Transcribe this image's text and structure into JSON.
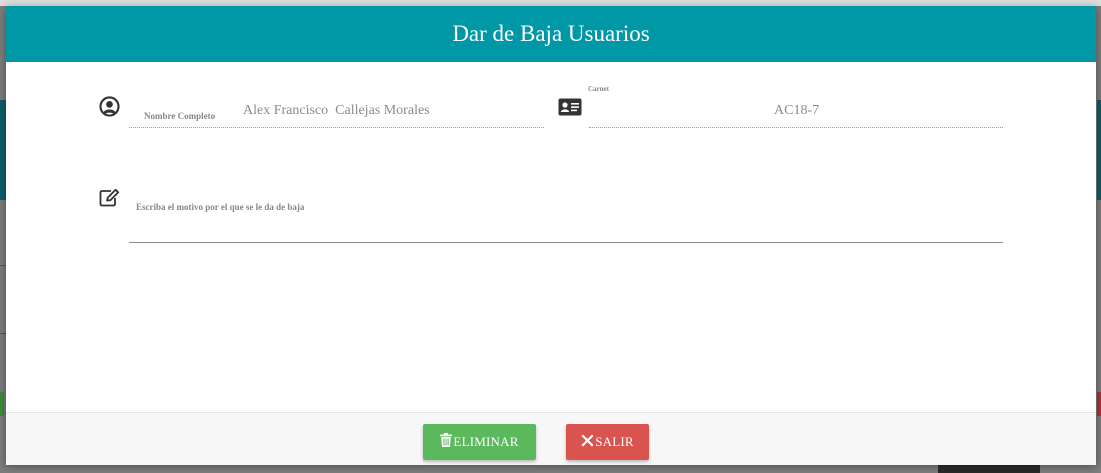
{
  "modal": {
    "title": "Dar de Baja Usuarios"
  },
  "form": {
    "nombre": {
      "label": "Nombre Completo",
      "value": "Alex Francisco  Callejas Morales",
      "icon": "user-circle-icon"
    },
    "carnet": {
      "label": "Carnet",
      "value": "AC18-7",
      "icon": "id-card-icon"
    },
    "motivo": {
      "label": "Escriba el motivo por el que se le da de baja",
      "value": "",
      "icon": "edit-icon"
    }
  },
  "footer": {
    "delete_label": "ELIMINAR",
    "exit_label": "SALIR",
    "delete_icon": "trash-icon",
    "exit_icon": "close-icon",
    "delete_color": "#5cb85c",
    "exit_color": "#d9534f"
  },
  "colors": {
    "header": "#0097a7"
  }
}
